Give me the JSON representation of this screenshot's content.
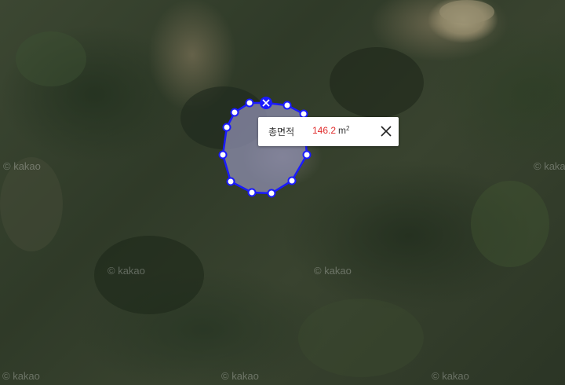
{
  "map": {
    "watermark": "© kakao",
    "style": "satellite"
  },
  "measurement": {
    "label": "총면적",
    "value": "146.2",
    "unit": "m",
    "unit_sup": "2",
    "polygon_color": "#1a1aff",
    "fill_color": "#8f8fb0",
    "close_icon": "close-icon",
    "delete_icon": "delete-vertex-icon"
  }
}
